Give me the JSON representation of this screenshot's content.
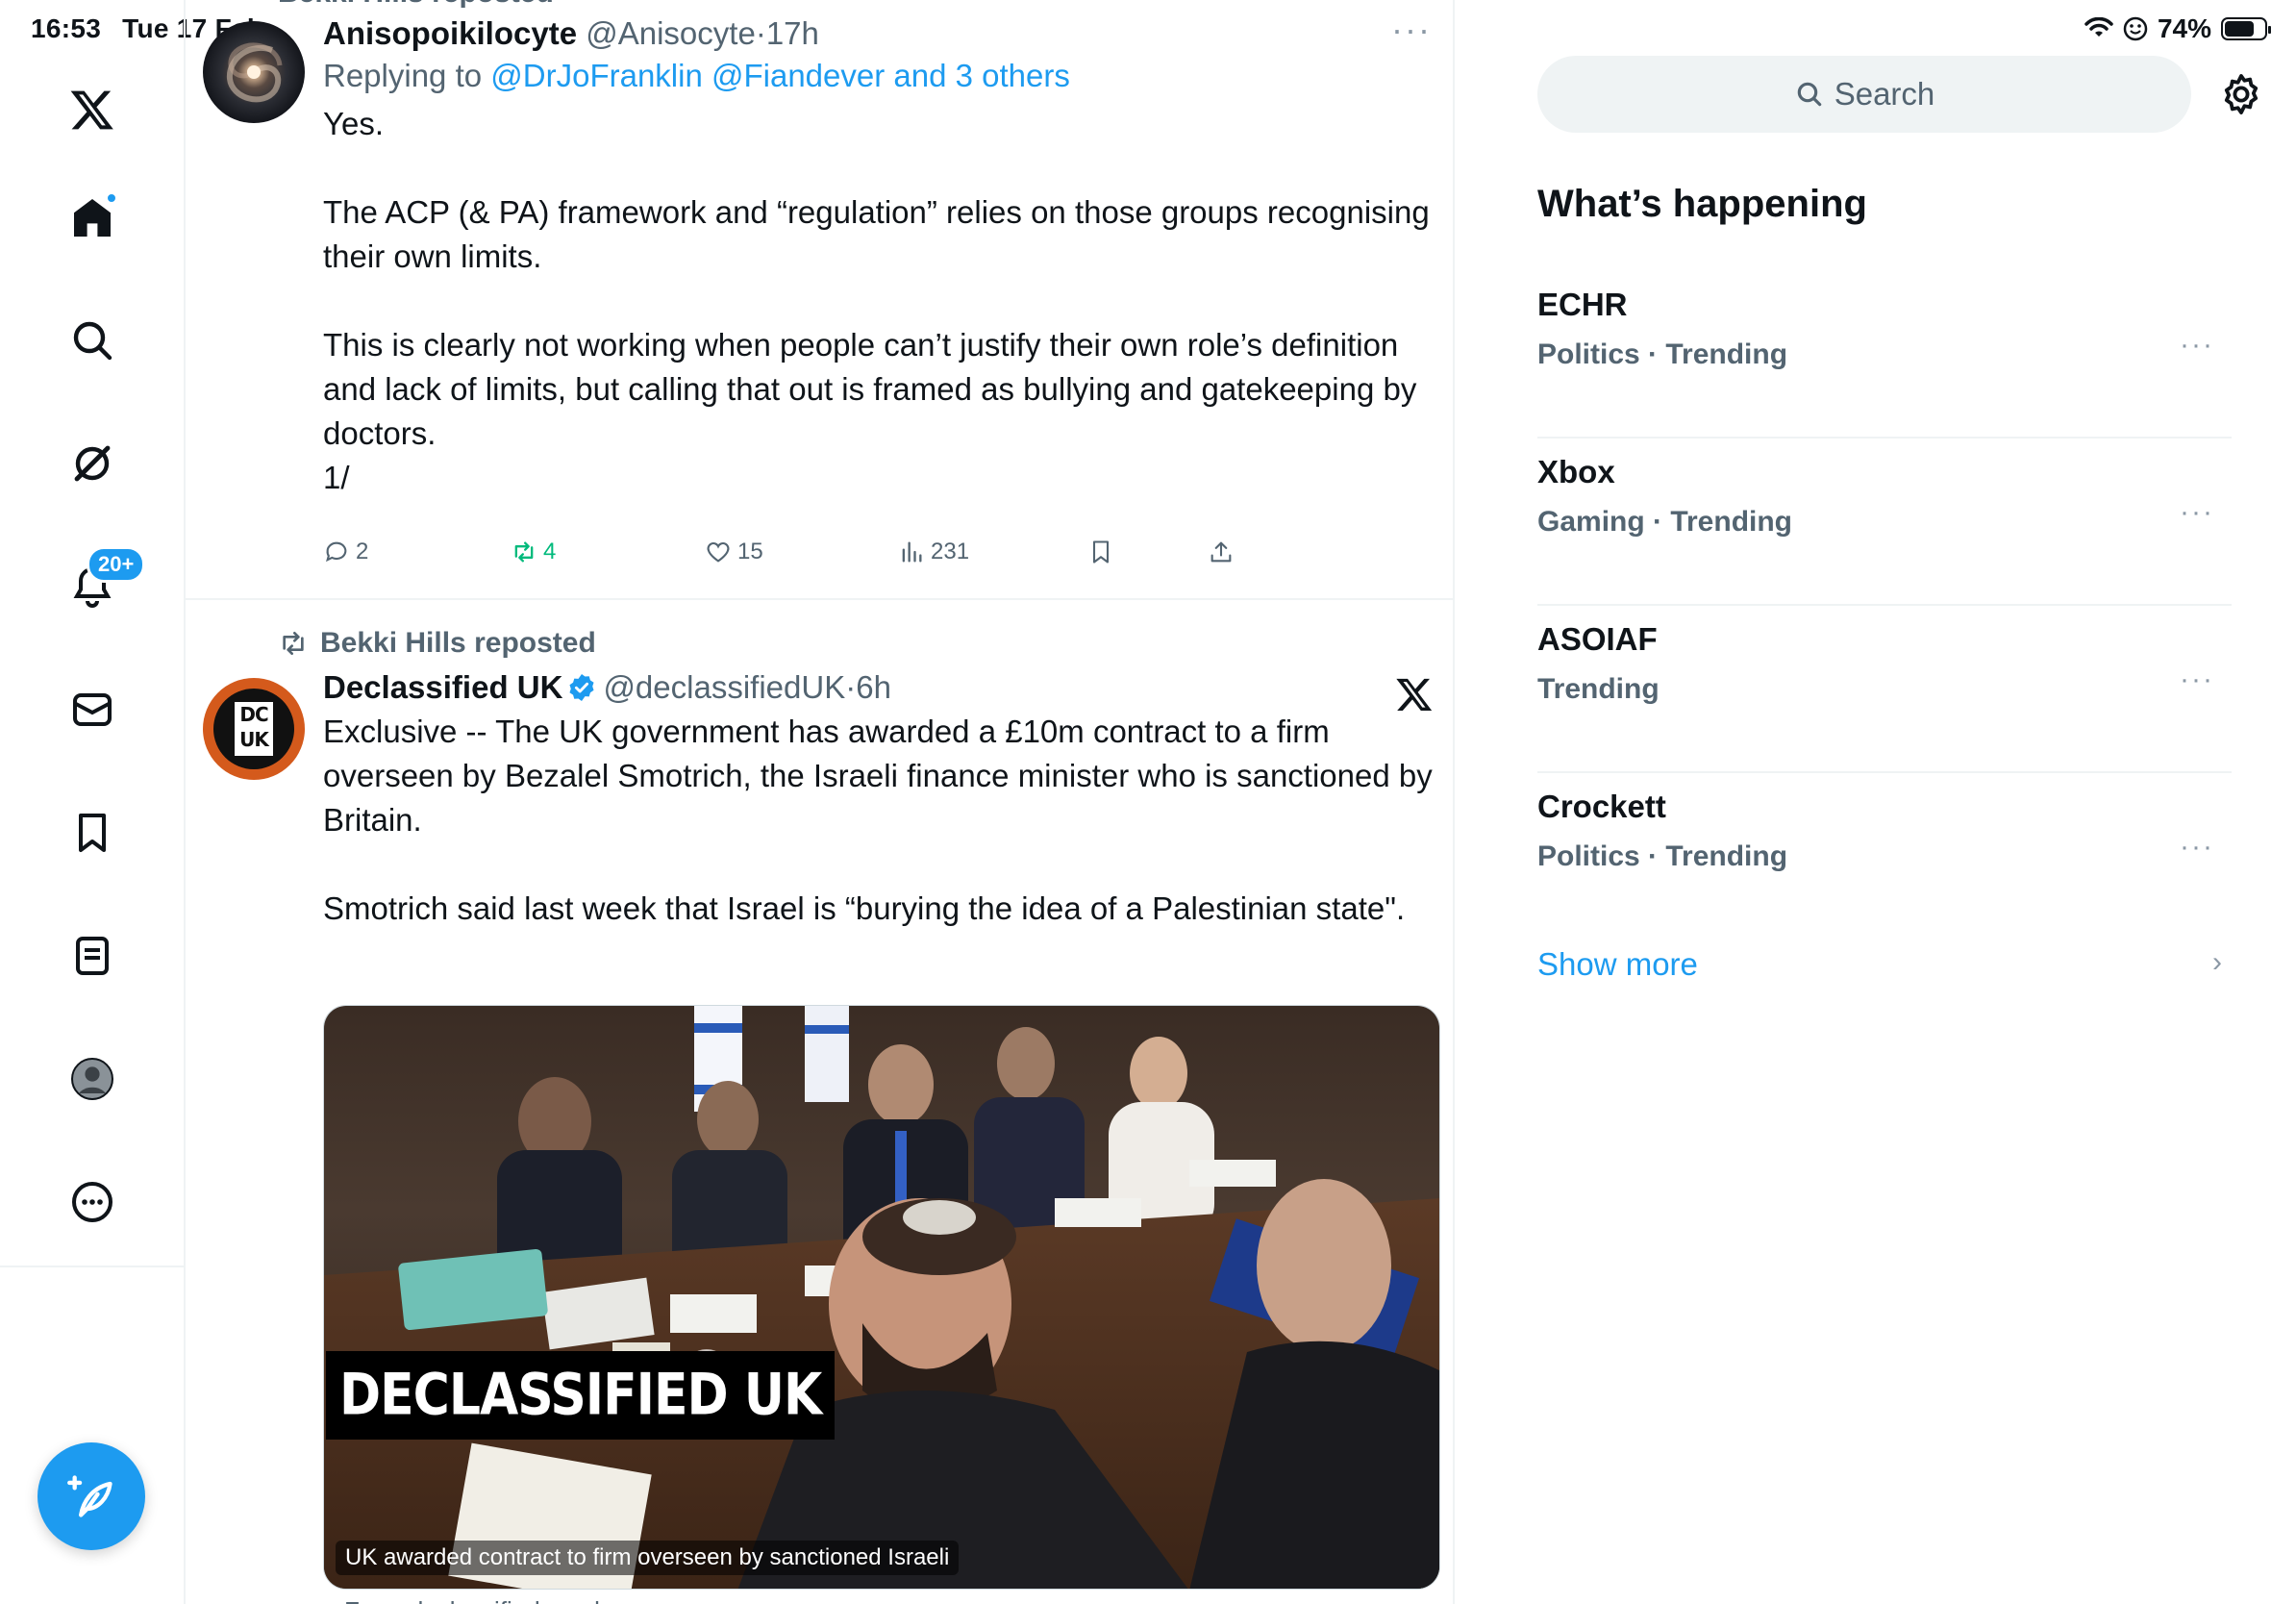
{
  "status_bar": {
    "time": "16:53",
    "date": "Tue 17 Feb",
    "battery": "74%"
  },
  "nav": {
    "items": [
      "x-logo",
      "home",
      "search",
      "grok",
      "notifications",
      "messages",
      "bookmarks",
      "lists",
      "profile",
      "more"
    ],
    "notifications_badge": "20+"
  },
  "timeline": {
    "top_repost_label": "Bekki Hills reposted",
    "tweet1": {
      "name": "Anisopoikilocyte",
      "handle": "@Anisocyte",
      "time": "17h",
      "replying_prefix": "Replying to",
      "replying_to": "@DrJoFranklin @Fiandever and 3 others",
      "text": "Yes.\n\nThe ACP (& PA) framework and “regulation” relies on those groups recognising their own limits.\n\nThis is clearly not working when people can’t justify their own role’s definition and lack of limits, but calling that out is framed as bullying and gatekeeping by doctors.\n1/",
      "replies": "2",
      "reposts": "4",
      "likes": "15",
      "views": "231"
    },
    "tweet2": {
      "repost_label": "Bekki Hills reposted",
      "name": "Declassified UK",
      "handle": "@declassifiedUK",
      "time": "6h",
      "avatar_text_1": "DC",
      "avatar_text_2": "UK",
      "text": "Exclusive -- The UK government has awarded a £10m contract to a firm overseen by Bezalel Smotrich, the Israeli finance minister who is sanctioned by Britain.\n\nSmotrich said last week that Israel is “burying the idea of a Palestinian state\".",
      "media_label": "DECLASSIFIED UK",
      "media_caption": "UK awarded contract to firm overseen by sanctioned Israeli",
      "from_line": "From declassified.co.uk"
    }
  },
  "right": {
    "search_placeholder": "Search",
    "whats_happening": "What’s happening",
    "trends": [
      {
        "name": "ECHR",
        "meta": "Politics · Trending"
      },
      {
        "name": "Xbox",
        "meta": "Gaming · Trending"
      },
      {
        "name": "ASOIAF",
        "meta": "Trending"
      },
      {
        "name": "Crockett",
        "meta": "Politics · Trending"
      }
    ],
    "show_more": "Show more"
  },
  "colors": {
    "accent": "#1d9bf0",
    "secondary_text": "#536471",
    "repost_green": "#00ba7c",
    "border": "#eff3f4"
  }
}
